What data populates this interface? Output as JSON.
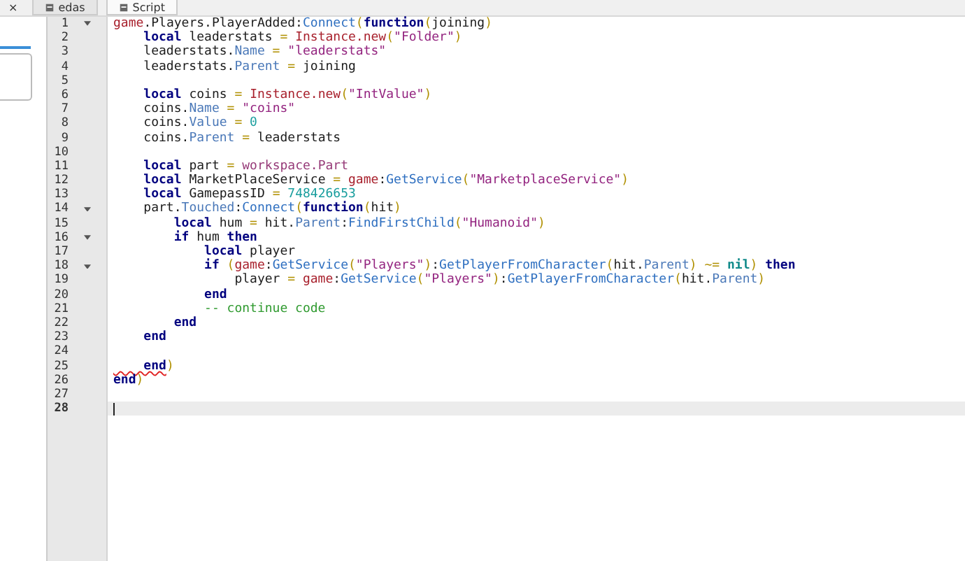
{
  "tabs": [
    {
      "label": "×",
      "kind": "close"
    },
    {
      "label": "edas",
      "kind": "tab",
      "selected": false
    },
    {
      "label": "Script",
      "kind": "tab",
      "selected": true
    }
  ],
  "editor": {
    "lines": [
      {
        "number": "1",
        "fold": true,
        "current": false,
        "tokens": [
          {
            "text": "game",
            "kind": "glob"
          },
          {
            "text": ".Players.PlayerAdded:",
            "kind": "txt"
          },
          {
            "text": "Connect",
            "kind": "fn"
          },
          {
            "text": "(",
            "kind": "op"
          },
          {
            "text": "function",
            "kind": "kw"
          },
          {
            "text": "(",
            "kind": "op"
          },
          {
            "text": "joining",
            "kind": "txt"
          },
          {
            "text": ")",
            "kind": "op"
          }
        ]
      },
      {
        "number": "2",
        "fold": false,
        "current": false,
        "tokens": [
          {
            "text": "    local",
            "kind": "kw"
          },
          {
            "text": " leaderstats ",
            "kind": "txt"
          },
          {
            "text": "= ",
            "kind": "op"
          },
          {
            "text": "Instance.new",
            "kind": "glob"
          },
          {
            "text": "(",
            "kind": "op"
          },
          {
            "text": "\"Folder\"",
            "kind": "str"
          },
          {
            "text": ")",
            "kind": "op"
          }
        ]
      },
      {
        "number": "3",
        "fold": false,
        "current": false,
        "tokens": [
          {
            "text": "    leaderstats.",
            "kind": "txt"
          },
          {
            "text": "Name",
            "kind": "prop"
          },
          {
            "text": " = ",
            "kind": "op"
          },
          {
            "text": "\"leaderstats\"",
            "kind": "str"
          }
        ]
      },
      {
        "number": "4",
        "fold": false,
        "current": false,
        "tokens": [
          {
            "text": "    leaderstats.",
            "kind": "txt"
          },
          {
            "text": "Parent",
            "kind": "prop"
          },
          {
            "text": " = ",
            "kind": "op"
          },
          {
            "text": "joining",
            "kind": "txt"
          }
        ]
      },
      {
        "number": "5",
        "fold": false,
        "current": false
      },
      {
        "number": "6",
        "fold": false,
        "current": false,
        "tokens": [
          {
            "text": "    local",
            "kind": "kw"
          },
          {
            "text": " coins ",
            "kind": "txt"
          },
          {
            "text": "= ",
            "kind": "op"
          },
          {
            "text": "Instance.new",
            "kind": "glob"
          },
          {
            "text": "(",
            "kind": "op"
          },
          {
            "text": "\"IntValue\"",
            "kind": "str"
          },
          {
            "text": ")",
            "kind": "op"
          }
        ]
      },
      {
        "number": "7",
        "fold": false,
        "current": false,
        "tokens": [
          {
            "text": "    coins.",
            "kind": "txt"
          },
          {
            "text": "Name",
            "kind": "prop"
          },
          {
            "text": " = ",
            "kind": "op"
          },
          {
            "text": "\"coins\"",
            "kind": "str"
          }
        ]
      },
      {
        "number": "8",
        "fold": false,
        "current": false,
        "tokens": [
          {
            "text": "    coins.",
            "kind": "txt"
          },
          {
            "text": "Value",
            "kind": "prop"
          },
          {
            "text": " = ",
            "kind": "op"
          },
          {
            "text": "0",
            "kind": "num"
          }
        ]
      },
      {
        "number": "9",
        "fold": false,
        "current": false,
        "tokens": [
          {
            "text": "    coins.",
            "kind": "txt"
          },
          {
            "text": "Parent",
            "kind": "prop"
          },
          {
            "text": " = ",
            "kind": "op"
          },
          {
            "text": "leaderstats",
            "kind": "txt"
          }
        ]
      },
      {
        "number": "10",
        "fold": false,
        "current": false
      },
      {
        "number": "11",
        "fold": false,
        "current": false,
        "tokens": [
          {
            "text": "    local",
            "kind": "kw"
          },
          {
            "text": " part ",
            "kind": "txt"
          },
          {
            "text": "= ",
            "kind": "op"
          },
          {
            "text": "workspace.Part",
            "kind": "lib"
          }
        ]
      },
      {
        "number": "12",
        "fold": false,
        "current": false,
        "tokens": [
          {
            "text": "    local",
            "kind": "kw"
          },
          {
            "text": " MarketPlaceService ",
            "kind": "txt"
          },
          {
            "text": "= ",
            "kind": "op"
          },
          {
            "text": "game",
            "kind": "glob"
          },
          {
            "text": ":",
            "kind": "txt"
          },
          {
            "text": "GetService",
            "kind": "fn"
          },
          {
            "text": "(",
            "kind": "op"
          },
          {
            "text": "\"MarketplaceService\"",
            "kind": "str"
          },
          {
            "text": ")",
            "kind": "op"
          }
        ]
      },
      {
        "number": "13",
        "fold": false,
        "current": false,
        "tokens": [
          {
            "text": "    local",
            "kind": "kw"
          },
          {
            "text": " GamepassID ",
            "kind": "txt"
          },
          {
            "text": "= ",
            "kind": "op"
          },
          {
            "text": "748426653",
            "kind": "num"
          }
        ]
      },
      {
        "number": "14",
        "fold": true,
        "current": false,
        "tokens": [
          {
            "text": "    part.",
            "kind": "txt"
          },
          {
            "text": "Touched",
            "kind": "prop"
          },
          {
            "text": ":",
            "kind": "txt"
          },
          {
            "text": "Connect",
            "kind": "fn"
          },
          {
            "text": "(",
            "kind": "op"
          },
          {
            "text": "function",
            "kind": "kw"
          },
          {
            "text": "(",
            "kind": "op"
          },
          {
            "text": "hit",
            "kind": "txt"
          },
          {
            "text": ")",
            "kind": "op"
          }
        ]
      },
      {
        "number": "15",
        "fold": false,
        "current": false,
        "tokens": [
          {
            "text": "        local",
            "kind": "kw"
          },
          {
            "text": " hum ",
            "kind": "txt"
          },
          {
            "text": "= ",
            "kind": "op"
          },
          {
            "text": "hit.",
            "kind": "txt"
          },
          {
            "text": "Parent",
            "kind": "prop"
          },
          {
            "text": ":",
            "kind": "txt"
          },
          {
            "text": "FindFirstChild",
            "kind": "fn"
          },
          {
            "text": "(",
            "kind": "op"
          },
          {
            "text": "\"Humanoid\"",
            "kind": "str"
          },
          {
            "text": ")",
            "kind": "op"
          }
        ]
      },
      {
        "number": "16",
        "fold": true,
        "current": false,
        "tokens": [
          {
            "text": "        if",
            "kind": "kw"
          },
          {
            "text": " hum ",
            "kind": "txt"
          },
          {
            "text": "then",
            "kind": "kw"
          }
        ]
      },
      {
        "number": "17",
        "fold": false,
        "current": false,
        "tokens": [
          {
            "text": "            local",
            "kind": "kw"
          },
          {
            "text": " player",
            "kind": "txt"
          }
        ]
      },
      {
        "number": "18",
        "fold": true,
        "current": false,
        "tokens": [
          {
            "text": "            if",
            "kind": "kw"
          },
          {
            "text": " (",
            "kind": "op"
          },
          {
            "text": "game",
            "kind": "glob"
          },
          {
            "text": ":",
            "kind": "txt"
          },
          {
            "text": "GetService",
            "kind": "fn"
          },
          {
            "text": "(",
            "kind": "op"
          },
          {
            "text": "\"Players\"",
            "kind": "str"
          },
          {
            "text": ")",
            "kind": "op"
          },
          {
            "text": ":",
            "kind": "txt"
          },
          {
            "text": "GetPlayerFromCharacter",
            "kind": "fn"
          },
          {
            "text": "(",
            "kind": "op"
          },
          {
            "text": "hit.",
            "kind": "txt"
          },
          {
            "text": "Parent",
            "kind": "prop"
          },
          {
            "text": ") ~= ",
            "kind": "op"
          },
          {
            "text": "nil",
            "kind": "nil"
          },
          {
            "text": ") ",
            "kind": "op"
          },
          {
            "text": "then",
            "kind": "kw"
          }
        ]
      },
      {
        "number": "19",
        "fold": false,
        "current": false,
        "tokens": [
          {
            "text": "                player ",
            "kind": "txt"
          },
          {
            "text": "= ",
            "kind": "op"
          },
          {
            "text": "game",
            "kind": "glob"
          },
          {
            "text": ":",
            "kind": "txt"
          },
          {
            "text": "GetService",
            "kind": "fn"
          },
          {
            "text": "(",
            "kind": "op"
          },
          {
            "text": "\"Players\"",
            "kind": "str"
          },
          {
            "text": ")",
            "kind": "op"
          },
          {
            "text": ":",
            "kind": "txt"
          },
          {
            "text": "GetPlayerFromCharacter",
            "kind": "fn"
          },
          {
            "text": "(",
            "kind": "op"
          },
          {
            "text": "hit.",
            "kind": "txt"
          },
          {
            "text": "Parent",
            "kind": "prop"
          },
          {
            "text": ")",
            "kind": "op"
          }
        ]
      },
      {
        "number": "20",
        "fold": false,
        "current": false,
        "tokens": [
          {
            "text": "            end",
            "kind": "kw"
          }
        ]
      },
      {
        "number": "21",
        "fold": false,
        "current": false,
        "tokens": [
          {
            "text": "            -- continue code",
            "kind": "cmt"
          }
        ]
      },
      {
        "number": "22",
        "fold": false,
        "current": false,
        "tokens": [
          {
            "text": "        end",
            "kind": "kw"
          }
        ]
      },
      {
        "number": "23",
        "fold": false,
        "current": false,
        "tokens": [
          {
            "text": "    end",
            "kind": "kw"
          }
        ]
      },
      {
        "number": "24",
        "fold": false,
        "current": false
      },
      {
        "number": "25",
        "fold": false,
        "current": false,
        "tokens": [
          {
            "text": "    end",
            "kind": "err"
          },
          {
            "text": ")",
            "kind": "op"
          }
        ]
      },
      {
        "number": "26",
        "fold": false,
        "current": false,
        "tokens": [
          {
            "text": "end",
            "kind": "kw"
          },
          {
            "text": ")",
            "kind": "op"
          }
        ]
      },
      {
        "number": "27",
        "fold": false,
        "current": false
      },
      {
        "number": "28",
        "fold": false,
        "current": true
      }
    ]
  }
}
